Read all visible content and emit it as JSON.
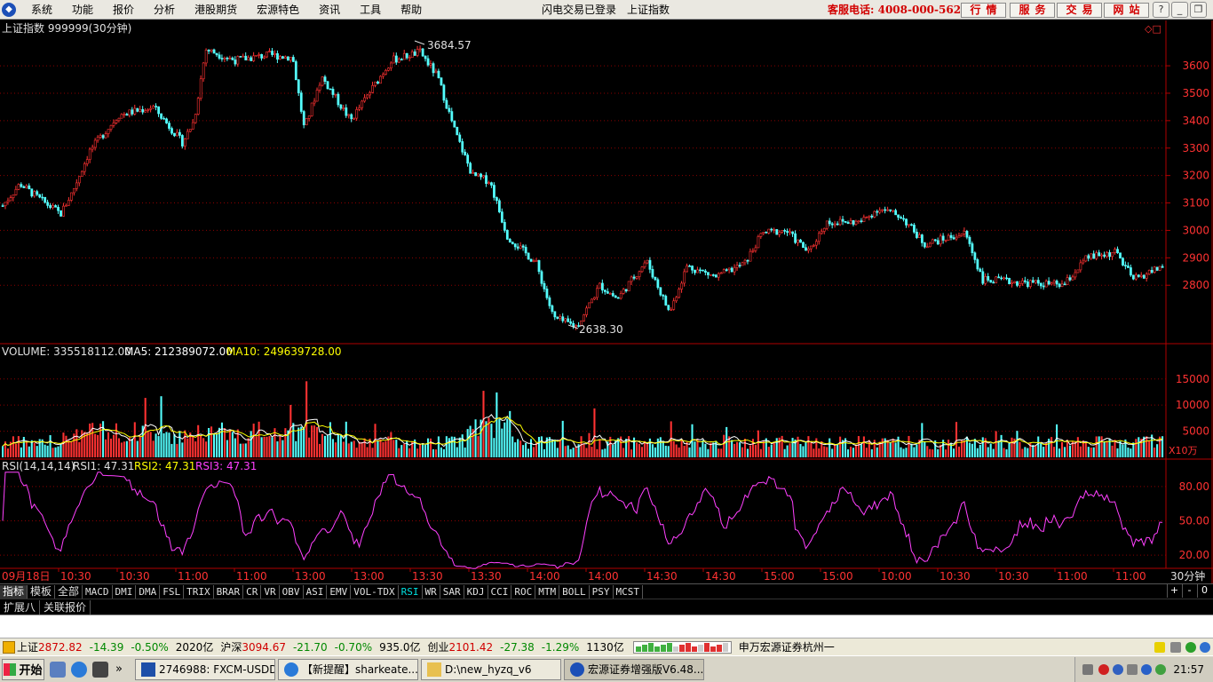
{
  "menubar": {
    "items": [
      "系统",
      "功能",
      "报价",
      "分析",
      "港股期货",
      "宏源特色",
      "资讯",
      "工具",
      "帮助"
    ],
    "status_login": "闪电交易已登录",
    "status_index": "上证指数",
    "hotline": "客服电话: 4008-000-562",
    "buttons": [
      "行情",
      "服务",
      "交易",
      "网站"
    ],
    "window_controls": [
      "?",
      "_",
      "❐",
      "✕"
    ]
  },
  "chart": {
    "title": "上证指数 999999(30分钟)",
    "price_high_label": "3684.57",
    "price_low_label": "2638.30",
    "price_ticks": [
      "3600",
      "3500",
      "3400",
      "3300",
      "3200",
      "3100",
      "3000",
      "2900",
      "2800"
    ],
    "volume_label": "VOLUME: 335518112.00",
    "ma5_label": "MA5: 212389072.00",
    "ma10_label": "MA10: 249639728.00",
    "volume_ticks": [
      "15000",
      "10000",
      "5000"
    ],
    "volume_unit": "X10万",
    "rsi_label": "RSI(14,14,14)",
    "rsi1_label": "RSI1: 47.31",
    "rsi2_label": "RSI2: 47.31",
    "rsi3_label": "RSI3: 47.31",
    "rsi_ticks": [
      "80.00",
      "50.00",
      "20.00"
    ],
    "time_axis": [
      "09月18日",
      "10:30",
      "10:30",
      "11:00",
      "11:00",
      "13:00",
      "13:00",
      "13:30",
      "13:30",
      "14:00",
      "14:00",
      "14:30",
      "14:30",
      "15:00",
      "15:00",
      "10:00",
      "10:30",
      "10:30",
      "11:00",
      "11:00"
    ],
    "period": "30分钟",
    "colors": {
      "up": "#ff3232",
      "down": "#54ffff",
      "grid": "#8b0000",
      "ma5": "#ffffff",
      "ma10": "#ffff00",
      "rsi": "#ff40ff"
    }
  },
  "chart_data": {
    "type": "candlestick",
    "title": "上证指数 999999(30分钟)",
    "price_range": [
      2600,
      3720
    ],
    "price_high": 3684.57,
    "price_low": 2638.3,
    "price_path": [
      [
        0,
        3090
      ],
      [
        0.015,
        3170
      ],
      [
        0.03,
        3120
      ],
      [
        0.05,
        3060
      ],
      [
        0.06,
        3140
      ],
      [
        0.075,
        3290
      ],
      [
        0.1,
        3420
      ],
      [
        0.13,
        3450
      ],
      [
        0.155,
        3320
      ],
      [
        0.165,
        3400
      ],
      [
        0.175,
        3660
      ],
      [
        0.2,
        3620
      ],
      [
        0.23,
        3640
      ],
      [
        0.25,
        3630
      ],
      [
        0.26,
        3370
      ],
      [
        0.275,
        3560
      ],
      [
        0.3,
        3400
      ],
      [
        0.335,
        3620
      ],
      [
        0.36,
        3650
      ],
      [
        0.375,
        3560
      ],
      [
        0.39,
        3360
      ],
      [
        0.405,
        3200
      ],
      [
        0.42,
        3180
      ],
      [
        0.435,
        2980
      ],
      [
        0.46,
        2880
      ],
      [
        0.475,
        2680
      ],
      [
        0.495,
        2650
      ],
      [
        0.515,
        2800
      ],
      [
        0.53,
        2750
      ],
      [
        0.555,
        2890
      ],
      [
        0.575,
        2700
      ],
      [
        0.59,
        2870
      ],
      [
        0.615,
        2830
      ],
      [
        0.64,
        2880
      ],
      [
        0.655,
        2990
      ],
      [
        0.675,
        3000
      ],
      [
        0.695,
        2920
      ],
      [
        0.71,
        3030
      ],
      [
        0.74,
        3030
      ],
      [
        0.755,
        3080
      ],
      [
        0.775,
        3050
      ],
      [
        0.795,
        2950
      ],
      [
        0.83,
        2990
      ],
      [
        0.845,
        2820
      ],
      [
        0.88,
        2810
      ],
      [
        0.915,
        2800
      ],
      [
        0.935,
        2900
      ],
      [
        0.96,
        2920
      ],
      [
        0.975,
        2820
      ],
      [
        1.0,
        2870
      ]
    ],
    "volume_range": [
      0,
      17000
    ],
    "rsi_range": [
      10,
      90
    ]
  },
  "indicators": {
    "tabs": [
      "指标",
      "模板",
      "全部",
      "MACD",
      "DMI",
      "DMA",
      "FSL",
      "TRIX",
      "BRAR",
      "CR",
      "VR",
      "OBV",
      "ASI",
      "EMV",
      "VOL-TDX",
      "RSI",
      "WR",
      "SAR",
      "KDJ",
      "CCI",
      "ROC",
      "MTM",
      "BOLL",
      "PSY",
      "MCST"
    ],
    "active": "RSI",
    "zoom": [
      "+",
      "-",
      "0"
    ]
  },
  "ext_tabs": [
    "扩展八",
    "关联报价"
  ],
  "ticker": {
    "items": [
      {
        "name": "上证",
        "price": "2872.82",
        "change": "-14.39",
        "pct": "-0.50%",
        "amount": "2020亿"
      },
      {
        "name": "沪深",
        "price": "3094.67",
        "change": "-21.70",
        "pct": "-0.70%",
        "amount": "935.0亿"
      },
      {
        "name": "创业",
        "price": "2101.42",
        "change": "-27.38",
        "pct": "-1.29%",
        "amount": "1130亿"
      }
    ],
    "broker": "申万宏源证券杭州一"
  },
  "taskbar": {
    "start": "开始",
    "more": "»",
    "tasks": [
      "2746988: FXCM-USDDe...",
      "【新提醒】sharkeate...",
      "D:\\new_hyzq_v6",
      "宏源证券增强版V6.48..."
    ],
    "clock": "21:57"
  }
}
